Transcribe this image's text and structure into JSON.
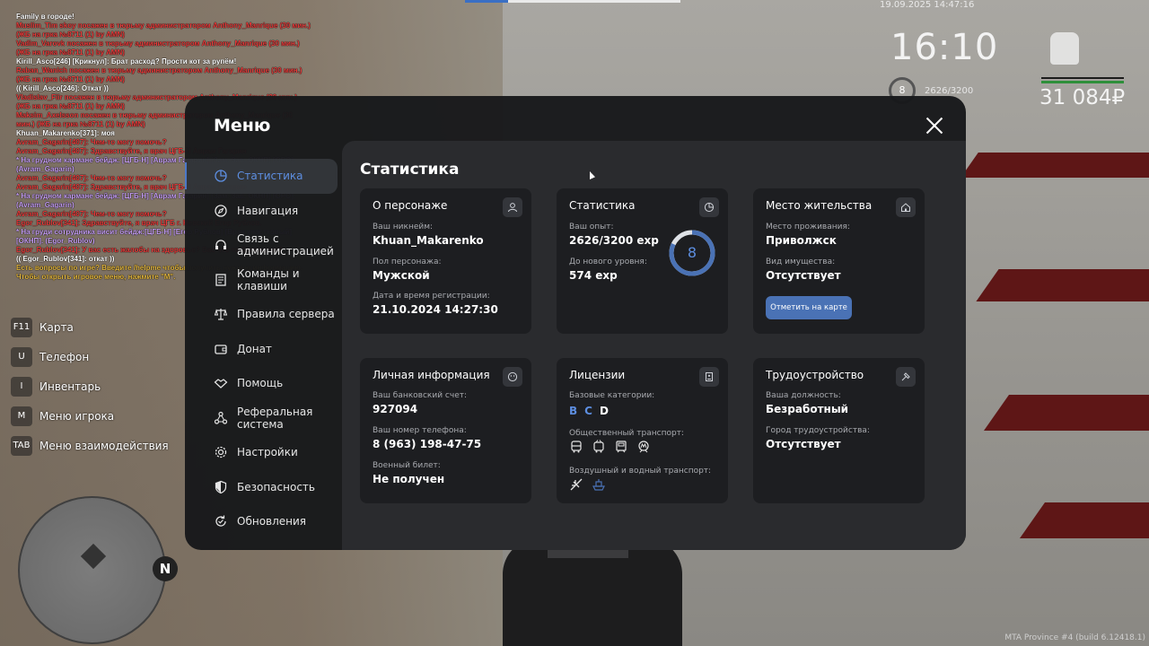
{
  "hud": {
    "date": "19.09.2025 14:47:16",
    "time": "16:10",
    "level": "8",
    "exp": "2626/3200",
    "money": "31 084₽"
  },
  "chat": [
    {
      "text": "Family в городе!",
      "color": "white"
    },
    {
      "text": "Muslim_Tim skoy посажен в тюрьму администратором Anthony_Manrique (30 мин.) (ЖБ на грка №8711 (1) by AMN)",
      "color": "red"
    },
    {
      "text": "Vadim_Varovk посажен в тюрьму администратором Anthony_Manrique (30 мин.) (ЖБ на грка №8711 (1) by AMN)",
      "color": "red"
    },
    {
      "text": "Kirill_Asco[246] [Крикнул]: Брат расход? Прости кот за рупём!",
      "color": "white"
    },
    {
      "text": "Raban_Wanich посажен в тюрьму администратором Anthony_Manrique (30 мин.) (ЖБ на грка №8711 (1) by AMN)",
      "color": "red"
    },
    {
      "text": "(( Kirill_Asco[246]: Откат ))",
      "color": "white"
    },
    {
      "text": "Vladislav_Fiir посажен в тюрьму администратором Anthony_Manrique (30 мин.) (ЖБ на грка №8711 (1) by AMN)",
      "color": "red"
    },
    {
      "text": "Maksim_Axelsson посажен в тюрьму администратором Anthony_Manrique (30 мин.) (ЖБ на грка №8711 (1) by AMN)",
      "color": "red"
    },
    {
      "text": "Khuan_Makarenko[371]: моя",
      "color": "white"
    },
    {
      "text": "Avram_Gagarin[407]: Чем-то могу помочь?",
      "color": "red"
    },
    {
      "text": "Avram_Gagarin[407]: Здравствуйте, я врач ЦГБ-Н Аврам Гагарин",
      "color": "red"
    },
    {
      "text": "* На грудном кармане бейдж: [ЦГБ-Н] [Аврам Гагарин] [Зам. Зав. ОКНП] [ОРО]. (Avram_Gagarin)",
      "color": "purple"
    },
    {
      "text": "Avram_Gagarin[407]: Чем-то могу помочь?",
      "color": "red"
    },
    {
      "text": "Avram_Gagarin[407]: Здравствуйте, я врач ЦГБ-Н Аврам Гагарин",
      "color": "red"
    },
    {
      "text": "* На грудном кармане бейдж: [ЦГБ-Н] [Аврам Гагарин] [Зам. Зав. ОКНП] [ОРО]. (Avram_Gagarin)",
      "color": "purple"
    },
    {
      "text": "Avram_Gagarin[407]: Чем-то могу помочь?",
      "color": "red"
    },
    {
      "text": "Egor_Rublov[341]: Здравствуйте, я врач ЦГБ г. Невский Егор Рублов.",
      "color": "red"
    },
    {
      "text": "* На груди сотрудника висит бейдж:[ЦГБ-Н] [Егор Рублов] [Врач участковый] [ОКНП]. (Egor_Rublov)",
      "color": "purple"
    },
    {
      "text": "Egor_Rublov[341]: У вас есть жалобы на здоровье? Вас что-то беспокоит?",
      "color": "red"
    },
    {
      "text": "(( Egor_Rublov[341]: откат ))",
      "color": "white"
    },
    {
      "text": "Есть вопросы по игре? Введите /helpme чтобы получить нужную информацию.",
      "color": "orange"
    },
    {
      "text": "Чтобы открыть игровое меню, нажмите \"M\".",
      "color": "orange"
    }
  ],
  "keybinds": [
    {
      "key": "F11",
      "label": "Карта"
    },
    {
      "key": "U",
      "label": "Телефон"
    },
    {
      "key": "I",
      "label": "Инвентарь"
    },
    {
      "key": "M",
      "label": "Меню игрока"
    },
    {
      "key": "TAB",
      "label": "Меню взаимодействия"
    }
  ],
  "minimap": {
    "compass": "N"
  },
  "menu": {
    "title": "Меню",
    "nav": [
      {
        "label": "Статистика",
        "icon": "pie-chart-icon",
        "active": true
      },
      {
        "label": "Навигация",
        "icon": "compass-icon",
        "active": false
      },
      {
        "label": "Связь с администрацией",
        "icon": "headset-icon",
        "active": false
      },
      {
        "label": "Команды и клавиши",
        "icon": "document-icon",
        "active": false
      },
      {
        "label": "Правила сервера",
        "icon": "scales-icon",
        "active": false
      },
      {
        "label": "Донат",
        "icon": "wallet-icon",
        "active": false
      },
      {
        "label": "Помощь",
        "icon": "handshake-icon",
        "active": false
      },
      {
        "label": "Реферальная система",
        "icon": "network-icon",
        "active": false
      },
      {
        "label": "Настройки",
        "icon": "gear-icon",
        "active": false
      },
      {
        "label": "Безопасность",
        "icon": "shield-icon",
        "active": false
      },
      {
        "label": "Обновления",
        "icon": "refresh-check-icon",
        "active": false
      }
    ],
    "content_title": "Статистика",
    "cards": {
      "persona": {
        "title": "О персонаже",
        "nick_label": "Ваш никнейм:",
        "nick": "Khuan_Makarenko",
        "gender_label": "Пол персонажа:",
        "gender": "Мужской",
        "reg_label": "Дата и время регистрации:",
        "reg": "21.10.2024 14:27:30"
      },
      "stats": {
        "title": "Статистика",
        "exp_label": "Ваш опыт:",
        "exp": "2626/3200 exp",
        "next_label": "До нового уровня:",
        "next": "574 exp",
        "level": "8",
        "progress": 0.82
      },
      "residence": {
        "title": "Место жительства",
        "place_label": "Место проживания:",
        "place": "Приволжск",
        "property_label": "Вид имущества:",
        "property": "Отсутствует",
        "map_button": "Отметить на карте"
      },
      "personal": {
        "title": "Личная информация",
        "bank_label": "Ваш банковский счет:",
        "bank": "927094",
        "phone_label": "Ваш номер телефона:",
        "phone": "8 (963) 198-47-75",
        "military_label": "Военный билет:",
        "military": "Не получен"
      },
      "licenses": {
        "title": "Лицензии",
        "base_label": "Базовые категории:",
        "cat_b": "B",
        "cat_c": "C",
        "cat_d": "D",
        "public_label": "Общественный транспорт:",
        "air_label": "Воздушный и водный транспорт:"
      },
      "employment": {
        "title": "Трудоустройство",
        "position_label": "Ваша должность:",
        "position": "Безработный",
        "city_label": "Город трудоустройства:",
        "city": "Отсутствует"
      }
    }
  },
  "watermark": "MTA Province #4 (build 6.12418.1)"
}
